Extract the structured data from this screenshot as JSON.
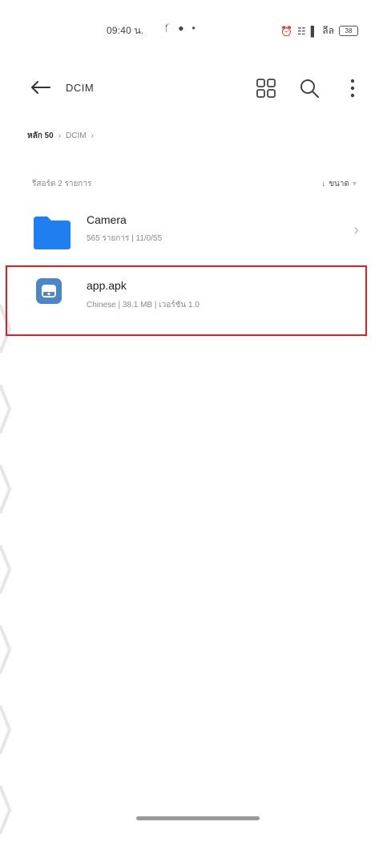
{
  "status_bar": {
    "time": "09:40 น.",
    "icons_left": [
      "bluetooth-icon",
      "messenger-icon",
      "dot-icon"
    ],
    "icons_right": [
      "alarm-icon",
      "wifi-calling-icon",
      "signal-icon"
    ],
    "carrier_text": "ลีล",
    "battery": "38"
  },
  "toolbar": {
    "title": "DCIM",
    "icons": [
      "grid-view-icon",
      "search-icon",
      "more-vert-icon"
    ]
  },
  "breadcrumb": {
    "root": "หลัก 50",
    "items": [
      "DCIM"
    ]
  },
  "list_header": {
    "count": "รีสอร์ต 2 รายการ",
    "sort_label": "ขนาด"
  },
  "files": [
    {
      "name": "Camera",
      "meta": "565 รายการ | 11/0/55",
      "type": "folder"
    },
    {
      "name": "app.apk",
      "meta": "Chinese | 38.1 MB | เวอร์ชัน 1.0",
      "type": "apk"
    }
  ],
  "colors": {
    "folder": "#1f7ff0",
    "apk_icon": "#4a86c8",
    "highlight": "#e41e1e"
  }
}
